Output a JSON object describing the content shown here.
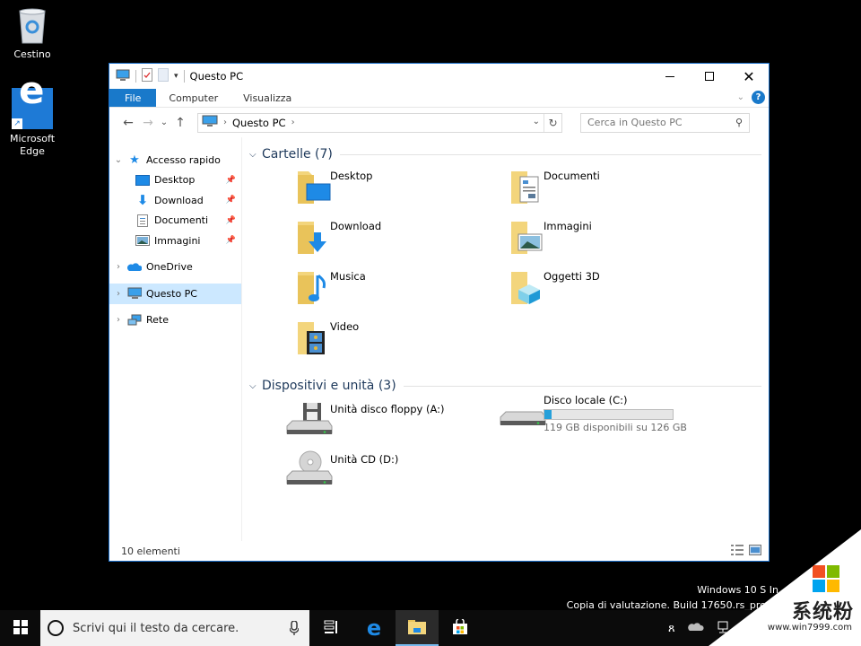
{
  "desktop": {
    "icons": [
      {
        "label": "Cestino",
        "icon": "recycle-bin-icon"
      },
      {
        "label": "Microsoft Edge",
        "icon": "edge-icon"
      }
    ]
  },
  "window": {
    "title": "Questo PC",
    "ribbon_tabs": [
      "File",
      "Computer",
      "Visualizza"
    ],
    "nav": {
      "back": "←",
      "forward": "→",
      "recent": "⌄",
      "up": "↑"
    },
    "address": {
      "crumb": "Questo PC",
      "chevron": "›"
    },
    "search_placeholder": "Cerca in Questo PC",
    "sidebar": {
      "quick_access": "Accesso rapido",
      "pinned": [
        "Desktop",
        "Download",
        "Documenti",
        "Immagini"
      ],
      "onedrive": "OneDrive",
      "this_pc": "Questo PC",
      "network": "Rete"
    },
    "groups": {
      "folders": {
        "title": "Cartelle (7)",
        "items": [
          "Desktop",
          "Documenti",
          "Download",
          "Immagini",
          "Musica",
          "Oggetti 3D",
          "Video"
        ]
      },
      "devices": {
        "title": "Dispositivi e unità (3)",
        "floppy": "Unità disco floppy (A:)",
        "local": {
          "name": "Disco locale (C:)",
          "free_text": "119 GB disponibili su 126 GB",
          "used_fraction": 0.056
        },
        "cd": "Unità CD (D:)"
      }
    },
    "status": "10 elementi"
  },
  "watermark": {
    "line1": "Windows 10 S In",
    "line2": "Copia di valutazione. Build 17650.rs_prerel"
  },
  "taskbar": {
    "search_placeholder": "Scrivi qui il testo da cercare."
  },
  "corner_brand": {
    "name": "系统粉",
    "url": "www.win7999.com",
    "colors": [
      "#f25022",
      "#7fba00",
      "#00a4ef",
      "#ffb900"
    ]
  }
}
